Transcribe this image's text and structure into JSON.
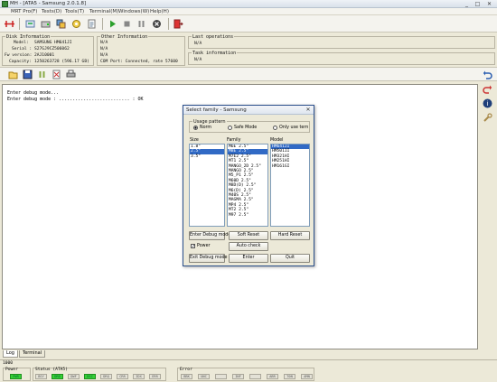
{
  "window": {
    "title": "MH - [ATA5 - Samsung 2.0.1.8]",
    "minimize_glyph": "_",
    "maximize_glyph": "□",
    "close_glyph": "✕"
  },
  "menu": [
    "MRT Pro(F)",
    "Tests(D)",
    "Tools(T)",
    "Terminal(M)",
    "Windows(W)",
    "Help(H)"
  ],
  "toolbar": {
    "icons": [
      "disconnect-icon",
      "reset-icon",
      "drive-icon",
      "modules-icon",
      "rom-icon",
      "info-icon",
      "run-icon",
      "stop-icon",
      "pause-icon",
      "cancel-icon",
      "exit-icon"
    ]
  },
  "disk_info": {
    "title": "Disk Information",
    "model_label": "Model:",
    "model_value": "SAMSUNG HM641JI",
    "serial_label": "Serial :",
    "serial_value": "S27GJ9CZ506062",
    "fw_label": "Fw version:",
    "fw_value": "2AJ10001",
    "capacity_label": "Capacity:",
    "capacity_value": "1250263728 (596.17 GB)"
  },
  "other_info": {
    "title": "Other Information",
    "line1": "N/A",
    "line2": "N/A",
    "line3": "N/A",
    "line4": "COM Port: Connected, rate 57600"
  },
  "last_operations": {
    "title": "Last operations",
    "value": "N/A"
  },
  "task_info": {
    "title": "Task information",
    "value": "N/A"
  },
  "console": {
    "lines": [
      "Enter debug mode...",
      "Enter debug mode : .......................... : OK"
    ]
  },
  "tabs": [
    "Log",
    "Terminal"
  ],
  "status": {
    "counter": "1000",
    "power_title": "Power",
    "power_led": "PWR",
    "status_title": "Status (ATA5)",
    "status_leds": [
      {
        "label": "BSY",
        "on": false
      },
      {
        "label": "DRD",
        "on": true
      },
      {
        "label": "DWF",
        "on": false
      },
      {
        "label": "DSC",
        "on": true
      },
      {
        "label": "DRQ",
        "on": false
      },
      {
        "label": "CRR",
        "on": false
      },
      {
        "label": "IDX",
        "on": false
      },
      {
        "label": "ERR",
        "on": false
      }
    ],
    "error_title": "Error",
    "error_leds": [
      "BBK",
      "UNC",
      "",
      "INF",
      "",
      "ABR",
      "T0N",
      "AMN"
    ]
  },
  "colors": {
    "led_on": "#35d035",
    "selection": "#316ac5",
    "dialog_border": "#2a4f8c"
  },
  "dialog": {
    "title": "Select family - Samsung",
    "usage_pattern_label": "Usage pattern",
    "radio_norm": "Norm",
    "radio_safe": "Safe Mode",
    "radio_only": "Only use tern",
    "size_header": "Size",
    "family_header": "Family",
    "model_header": "Model",
    "sizes": [
      "1.8\"",
      "2.5\"",
      "3.5\""
    ],
    "size_selected": 1,
    "families": [
      "M6E 2.5\"",
      "M8E 2.5\"",
      "M7E2 2.5\"",
      "MT1 2.5\"",
      "MANGO_2D 2.5\"",
      "MANGO 2.5\"",
      "M5_P1 2.5\"",
      "M60D 2.5\"",
      "M8D(D) 2.5\"",
      "M6(D) 2.5\"",
      "M40S 2.5\"",
      "MAGMA 2.5\"",
      "MP4 2.5\"",
      "MT2 2.5\"",
      "M97 2.5\""
    ],
    "family_selected": 1,
    "models": [
      "HM641JI",
      "HM501II",
      "HM321HI",
      "HM251HI",
      "HM161GI"
    ],
    "model_selected": 0,
    "btn_enter_debug": "Enter Debug mode",
    "btn_soft_reset": "Soft Reset",
    "btn_hard_reset": "Hard Reset",
    "chk_power": "Power",
    "btn_auto_check": "Auto check",
    "btn_exit_debug": "Exit Debug mode",
    "btn_enter": "Enter",
    "btn_quit": "Quit"
  }
}
